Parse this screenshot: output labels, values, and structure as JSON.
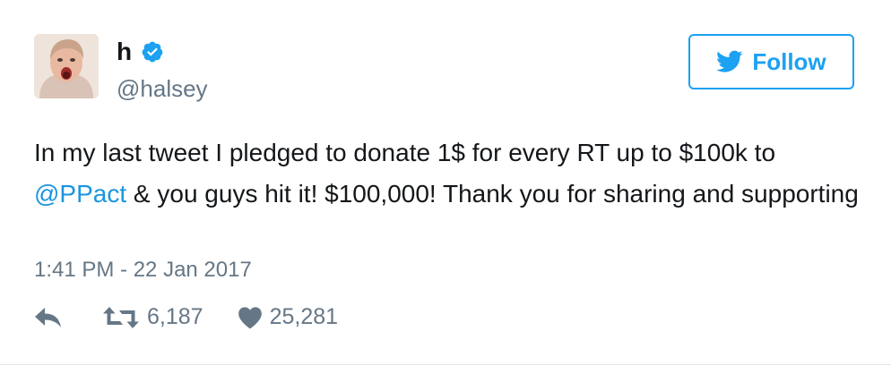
{
  "user": {
    "display_name": "h",
    "handle": "@halsey",
    "avatar_icon": "user-avatar",
    "verified_icon": "verified-badge-icon"
  },
  "follow": {
    "label": "Follow",
    "icon": "twitter-bird-icon"
  },
  "tweet": {
    "text_part1": "In my last tweet I pledged to donate 1$ for every RT up to $100k to ",
    "mention": "@PPact",
    "text_part2": " & you guys hit it! $100,000! Thank you for sharing and supporting",
    "timestamp": "1:41 PM - 22 Jan 2017"
  },
  "actions": {
    "reply_icon": "reply-icon",
    "retweet_icon": "retweet-icon",
    "retweet_count": "6,187",
    "like_icon": "heart-icon",
    "like_count": "25,281"
  },
  "colors": {
    "accent": "#1da1f2",
    "text": "#14171a",
    "muted": "#657786"
  }
}
